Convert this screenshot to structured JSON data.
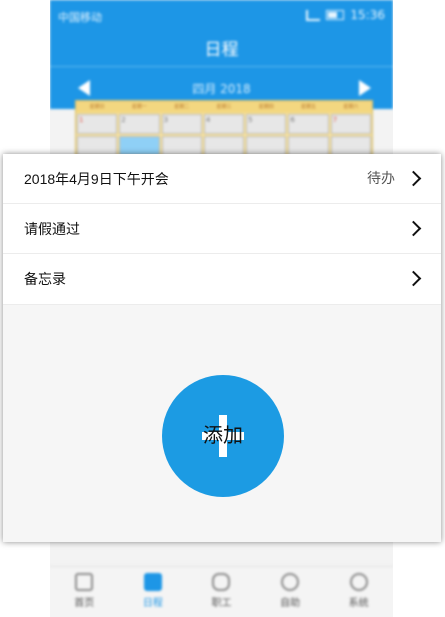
{
  "status_bar": {
    "carrier": "中国移动",
    "time": "15:36"
  },
  "app": {
    "title": "日程"
  },
  "calendar": {
    "month_label": "四月 2018",
    "weekdays": [
      "星期日",
      "星期一",
      "星期二",
      "星期三",
      "星期四",
      "星期五",
      "星期六"
    ],
    "days": [
      "1",
      "2",
      "3",
      "4",
      "5",
      "6",
      "7"
    ]
  },
  "sheet": {
    "items": [
      {
        "label": "2018年4月9日下午开会",
        "status": "待办"
      },
      {
        "label": "请假通过"
      },
      {
        "label": "备忘录"
      }
    ],
    "add_label": "添加"
  },
  "tabs": [
    {
      "label": "首页",
      "icon": "home-icon"
    },
    {
      "label": "日程",
      "icon": "calendar-icon",
      "active": true
    },
    {
      "label": "职工",
      "icon": "person-icon"
    },
    {
      "label": "自助",
      "icon": "check-circle-icon"
    },
    {
      "label": "系统",
      "icon": "settings-icon"
    }
  ],
  "colors": {
    "primary": "#1d96e6",
    "add_button": "#1c9be3"
  }
}
